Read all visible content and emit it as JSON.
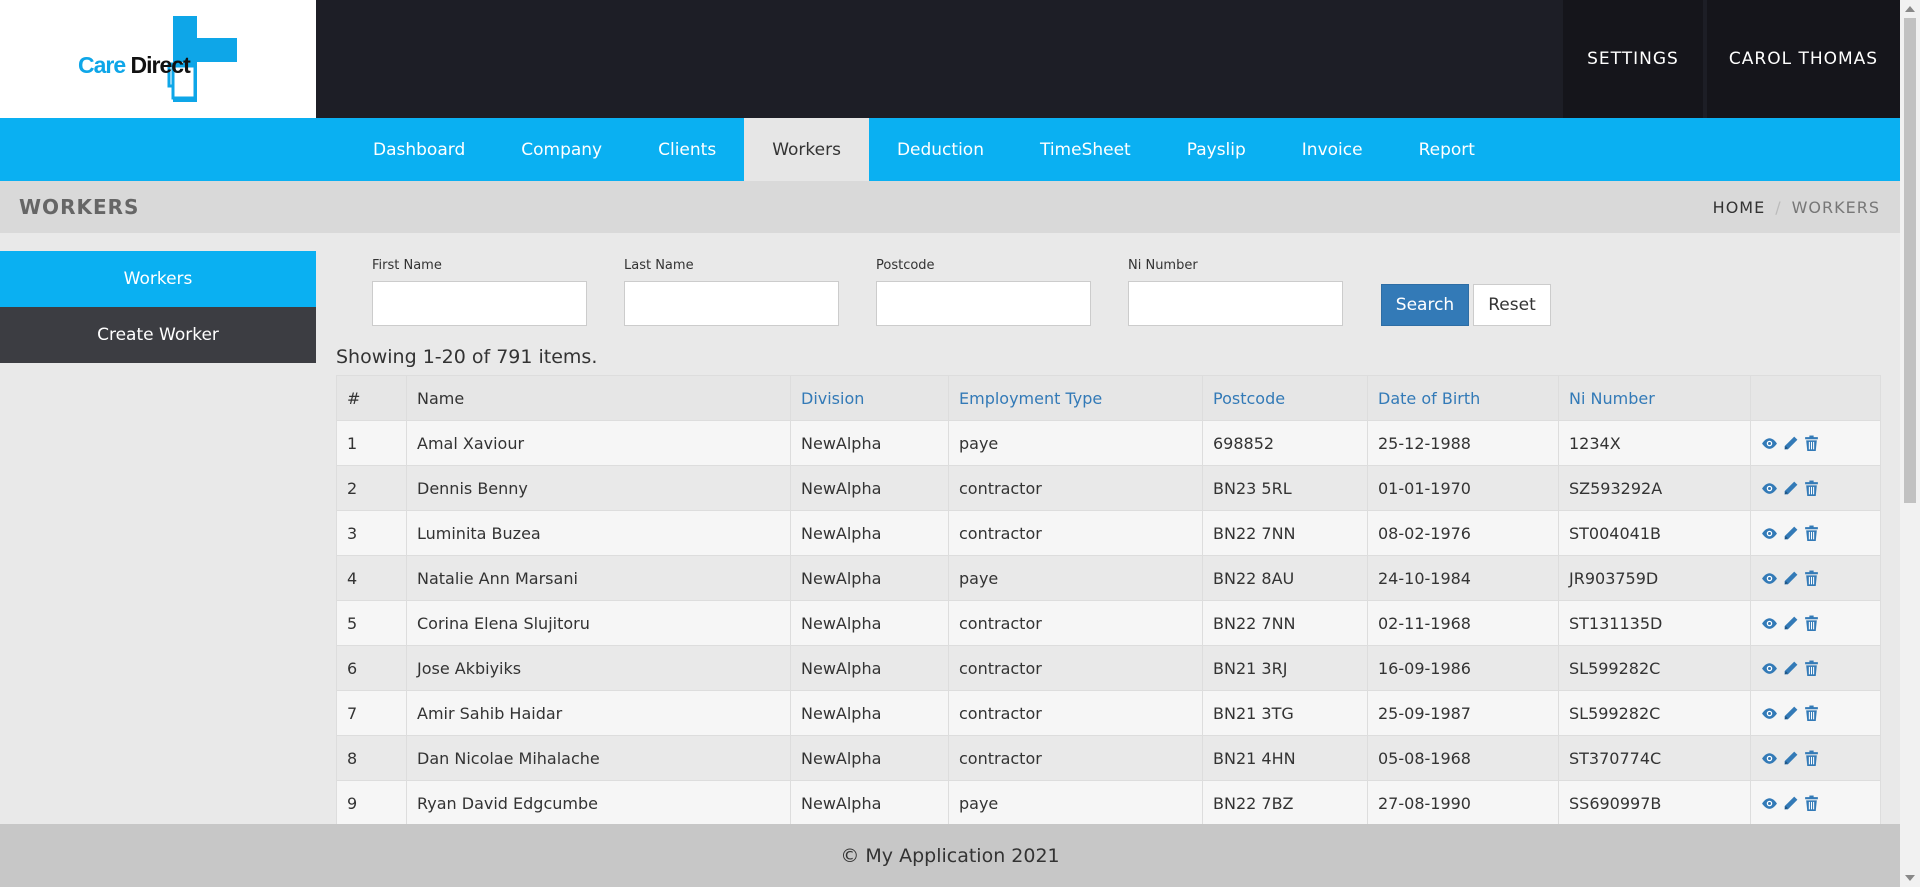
{
  "logo": {
    "part1": "Care",
    "part2": "Direct"
  },
  "top": {
    "settings_label": "SETTINGS",
    "user_label": "CAROL THOMAS"
  },
  "nav": {
    "items": [
      {
        "label": "Dashboard"
      },
      {
        "label": "Company"
      },
      {
        "label": "Clients"
      },
      {
        "label": "Workers"
      },
      {
        "label": "Deduction"
      },
      {
        "label": "TimeSheet"
      },
      {
        "label": "Payslip"
      },
      {
        "label": "Invoice"
      },
      {
        "label": "Report"
      }
    ],
    "active": "Workers"
  },
  "header": {
    "title": "WORKERS",
    "breadcrumb_home": "HOME",
    "breadcrumb_sep": "/",
    "breadcrumb_current": "WORKERS"
  },
  "sidebar": {
    "items": [
      {
        "label": "Workers"
      },
      {
        "label": "Create Worker"
      }
    ]
  },
  "filters": {
    "first_name_label": "First Name",
    "first_name_value": "",
    "last_name_label": "Last Name",
    "last_name_value": "",
    "postcode_label": "Postcode",
    "postcode_value": "",
    "ni_label": "Ni Number",
    "ni_value": "",
    "search_label": "Search",
    "reset_label": "Reset"
  },
  "summary": "Showing 1-20 of 791 items.",
  "table": {
    "headers": [
      "#",
      "Name",
      "Division",
      "Employment Type",
      "Postcode",
      "Date of Birth",
      "Ni Number",
      ""
    ],
    "rows": [
      [
        "1",
        "Amal Xaviour",
        "NewAlpha",
        "paye",
        "698852",
        "25-12-1988",
        "1234X"
      ],
      [
        "2",
        "Dennis Benny",
        "NewAlpha",
        "contractor",
        "BN23 5RL",
        "01-01-1970",
        "SZ593292A"
      ],
      [
        "3",
        "Luminita Buzea",
        "NewAlpha",
        "contractor",
        "BN22 7NN",
        "08-02-1976",
        "ST004041B"
      ],
      [
        "4",
        "Natalie Ann Marsani",
        "NewAlpha",
        "paye",
        "BN22 8AU",
        "24-10-1984",
        "JR903759D"
      ],
      [
        "5",
        "Corina Elena Slujitoru",
        "NewAlpha",
        "contractor",
        "BN22 7NN",
        "02-11-1968",
        "ST131135D"
      ],
      [
        "6",
        "Jose Akbiyiks",
        "NewAlpha",
        "contractor",
        "BN21 3RJ",
        "16-09-1986",
        "SL599282C"
      ],
      [
        "7",
        "Amir Sahib Haidar",
        "NewAlpha",
        "contractor",
        "BN21 3TG",
        "25-09-1987",
        "SL599282C"
      ],
      [
        "8",
        "Dan Nicolae Mihalache",
        "NewAlpha",
        "contractor",
        "BN21 4HN",
        "05-08-1968",
        "ST370774C"
      ],
      [
        "9",
        "Ryan David Edgcumbe",
        "NewAlpha",
        "paye",
        "BN22 7BZ",
        "27-08-1990",
        "SS690997B"
      ]
    ]
  },
  "footer": "© My Application 2021",
  "colors": {
    "accent": "#0ab0f2",
    "topbar": "#1d1e26",
    "link": "#337ab7",
    "sidebar_dark": "#3c3d42"
  },
  "icons": {
    "view": "eye-icon",
    "edit": "pencil-icon",
    "delete": "trash-icon"
  }
}
